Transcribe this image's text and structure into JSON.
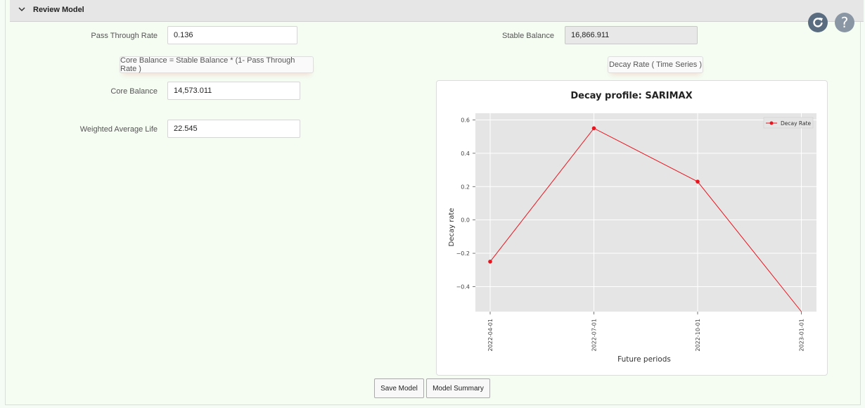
{
  "header": {
    "title": "Review Model"
  },
  "toolbar": {
    "refresh_icon": "refresh-icon",
    "help_icon": "help-icon",
    "help_glyph": "?"
  },
  "form": {
    "pass_through_rate": {
      "label": "Pass Through Rate",
      "value": "0.136"
    },
    "stable_balance": {
      "label": "Stable Balance",
      "value": "16,866.911"
    },
    "core_formula": "Core Balance = Stable Balance * (1- Pass Through Rate )",
    "decay_tab": "Decay Rate ( Time Series )",
    "core_balance": {
      "label": "Core Balance",
      "value": "14,573.011"
    },
    "wal": {
      "label": "Weighted Average Life",
      "value": "22.545"
    }
  },
  "buttons": {
    "save": "Save Model",
    "summary": "Model Summary"
  },
  "colors": {
    "series": "#e8141e",
    "plot_bg": "#e5e5e5",
    "accent_icon": "#5a6d80"
  },
  "chart_data": {
    "type": "line",
    "title": "Decay profile: SARIMAX",
    "xlabel": "Future periods",
    "ylabel": "Decay rate",
    "x": [
      "2022-04-01",
      "2022-07-01",
      "2022-10-01",
      "2023-01-01"
    ],
    "series": [
      {
        "name": "Decay Rate",
        "values": [
          -0.25,
          0.55,
          0.23,
          -0.55
        ]
      }
    ],
    "yticks": [
      "0.6",
      "0.4",
      "0.2",
      "0.0",
      "−0.2",
      "−0.4"
    ],
    "ylim": [
      -0.55,
      0.64
    ],
    "grid": true,
    "legend": "top-right"
  }
}
